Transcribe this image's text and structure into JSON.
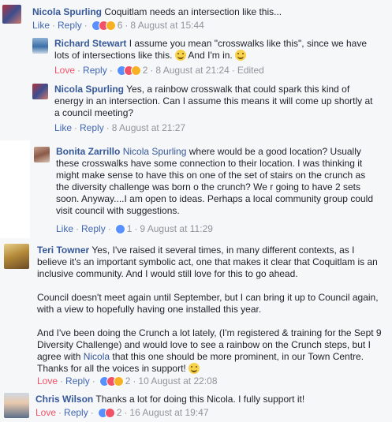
{
  "comments": [
    {
      "name": "Nicola Spurling",
      "text": "Coquitlam needs an intersection like this...",
      "actions": {
        "like": "Like",
        "reply": "Reply",
        "reactions": "6",
        "time": "8 August at 15:44"
      }
    },
    {
      "name": "Richard Stewart",
      "text": "I assume you mean \"crosswalks like this\", since we have lots of intersections like this.",
      "text_after": "And I'm in.",
      "actions": {
        "like": "Love",
        "reply": "Reply",
        "reactions": "2",
        "time": "8 August at 21:24",
        "edited": "Edited"
      }
    },
    {
      "name": "Nicola Spurling",
      "text": "Yes, a rainbow crosswalk that could spark this kind of energy in an intersection. Can I assume this means it will come up shortly at a council meeting?",
      "actions": {
        "like": "Like",
        "reply": "Reply",
        "time": "8 August at 21:27"
      }
    },
    {
      "name": "Bonita Zarrillo",
      "mention": "Nicola Spurling",
      "text": "where would be a good location? Usually these crosswalks have some connection to their location. I was thinking it might make sense to have this on one of the set of stairs on the crunch as the diversity challenge was born o the crunch? We r going to have 2 sets soon. Anyway....I am open to ideas. Perhaps a local community group could visit council with suggestions.",
      "actions": {
        "like": "Like",
        "reply": "Reply",
        "reactions": "1",
        "time": "9 August at 11:29"
      }
    },
    {
      "name": "Teri Towner",
      "text": "Yes, I've raised it several times, in many different contexts, as I believe it's an important symbolic act, one that makes it clear that Coquitlam is an inclusive community. And I would still love for this to go ahead.",
      "para2": "Council doesn't meet again until September, but I can bring it up to Council again, with a view to hopefully having one installed this year.",
      "para3_before": "And I've been doing the Crunch a lot lately, (I'm registered & training for the Sept 9 Diversity Challenge) and would love to see a rainbow on the Crunch steps, but I agree with",
      "para3_mention": "Nicola",
      "para3_after": "that this one should be more prominent, in our Town Centre. Thanks for all the voices in support!",
      "actions": {
        "like": "Love",
        "reply": "Reply",
        "reactions": "2",
        "time": "10 August at 22:08"
      }
    },
    {
      "name": "Chris Wilson",
      "text": "Thanks a lot for doing this Nicola. I fully support it!",
      "actions": {
        "like": "Love",
        "reply": "Reply",
        "reactions": "2",
        "time": "16 August at 19:47"
      }
    }
  ],
  "colors": {
    "name": "#365899",
    "link": "#4267b2",
    "love": "#f25268",
    "meta": "#90949c",
    "panel": "#f6f7f9"
  }
}
